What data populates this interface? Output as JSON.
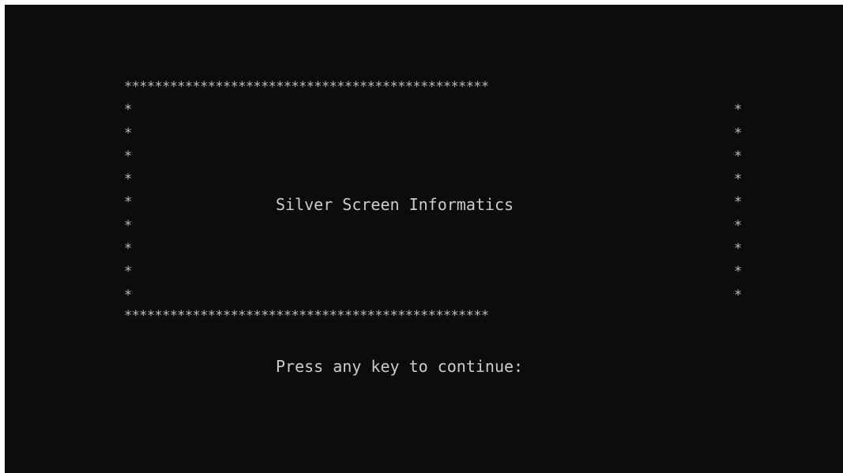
{
  "console": {
    "border_row": "************************************************",
    "side_char": "*",
    "title": "Silver Screen Informatics",
    "prompt": "Press any key to continue:"
  },
  "colors": {
    "background": "#0c0c0c",
    "text": "#cccccc"
  }
}
